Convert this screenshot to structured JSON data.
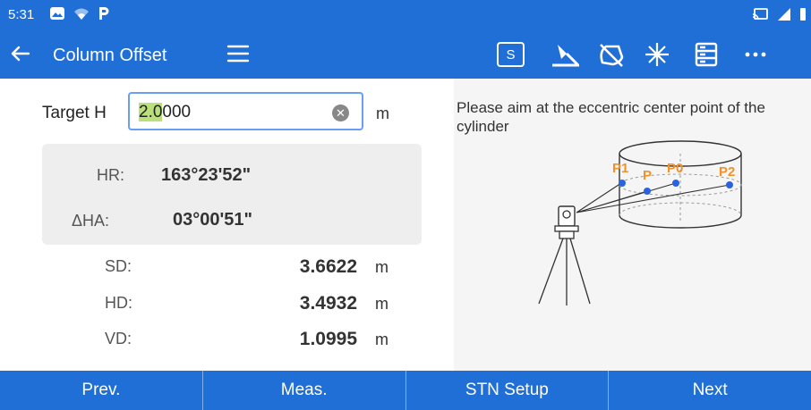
{
  "status_bar": {
    "time": "5:31"
  },
  "app_bar": {
    "title": "Column Offset",
    "s_button_label": "S"
  },
  "form": {
    "target_h": {
      "label": "Target H",
      "value_highlighted": "2.0",
      "value_rest": "000",
      "unit": "m"
    }
  },
  "angles": {
    "hr": {
      "label": "HR:",
      "value": "163°23'52\""
    },
    "dha": {
      "label": "ΔHA:",
      "value": "03°00'51\""
    }
  },
  "measurements": {
    "sd": {
      "label": "SD:",
      "value": "3.6622",
      "unit": "m"
    },
    "hd": {
      "label": "HD:",
      "value": "3.4932",
      "unit": "m"
    },
    "vd": {
      "label": "VD:",
      "value": "1.0995",
      "unit": "m"
    }
  },
  "diagram": {
    "instruction": "Please aim at the eccentric center point of the cylinder",
    "labels": {
      "p1": "P1",
      "p": "P",
      "p0": "P0",
      "p2": "P2"
    },
    "accent_color": "#f0922a",
    "point_color": "#2a62e0"
  },
  "bottom_bar": {
    "prev": "Prev.",
    "meas": "Meas.",
    "stn_setup": "STN Setup",
    "next": "Next"
  },
  "colors": {
    "primary": "#1f6fd6",
    "input_border": "#6a9ef5",
    "selection": "#b9e07a"
  }
}
